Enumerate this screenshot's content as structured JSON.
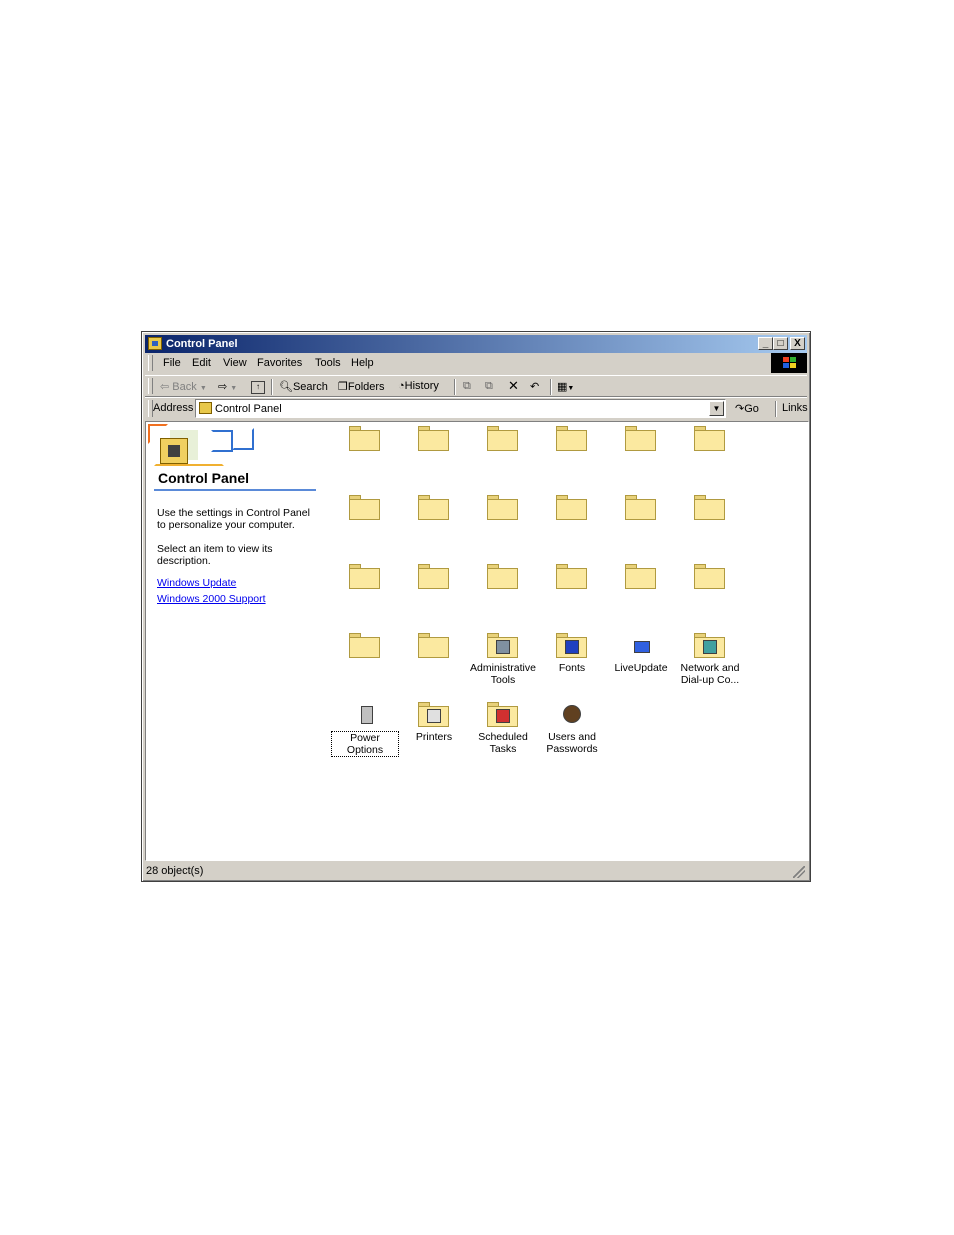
{
  "window": {
    "title": "Control Panel"
  },
  "title_buttons": {
    "minimize": "_",
    "maximize": "□",
    "close": "X"
  },
  "menu": [
    "File",
    "Edit",
    "View",
    "Favorites",
    "Tools",
    "Help"
  ],
  "toolbar": {
    "back": "Back",
    "search": "Search",
    "folders": "Folders",
    "history": "History"
  },
  "address": {
    "label": "Address",
    "value": "Control Panel",
    "go": "Go",
    "links": "Links"
  },
  "left_panel": {
    "title": "Control Panel",
    "description": "Use the settings in Control Panel to personalize your computer.",
    "hint": "Select an item to view its description.",
    "links": [
      "Windows Update",
      "Windows 2000 Support"
    ]
  },
  "items": [
    {
      "label": "",
      "icon": "folder-icon"
    },
    {
      "label": "",
      "icon": "folder-icon"
    },
    {
      "label": "",
      "icon": "folder-icon"
    },
    {
      "label": "",
      "icon": "folder-icon"
    },
    {
      "label": "",
      "icon": "folder-icon"
    },
    {
      "label": "",
      "icon": "folder-icon"
    },
    {
      "label": "",
      "icon": "folder-icon"
    },
    {
      "label": "",
      "icon": "folder-icon"
    },
    {
      "label": "",
      "icon": "folder-icon"
    },
    {
      "label": "",
      "icon": "folder-icon"
    },
    {
      "label": "",
      "icon": "folder-icon"
    },
    {
      "label": "",
      "icon": "folder-icon"
    },
    {
      "label": "",
      "icon": "folder-icon"
    },
    {
      "label": "",
      "icon": "folder-icon"
    },
    {
      "label": "",
      "icon": "folder-icon"
    },
    {
      "label": "",
      "icon": "folder-icon"
    },
    {
      "label": "",
      "icon": "folder-icon"
    },
    {
      "label": "",
      "icon": "folder-icon"
    },
    {
      "label": "",
      "icon": "folder-icon"
    },
    {
      "label": "",
      "icon": "folder-icon"
    },
    {
      "label": "Administrative Tools",
      "icon": "administrative-tools-icon"
    },
    {
      "label": "Fonts",
      "icon": "fonts-icon"
    },
    {
      "label": "LiveUpdate",
      "icon": "liveupdate-icon"
    },
    {
      "label": "Network and Dial-up Co...",
      "icon": "network-icon"
    },
    {
      "label": "Power Options",
      "icon": "power-options-icon",
      "selected": true
    },
    {
      "label": "Printers",
      "icon": "printers-icon"
    },
    {
      "label": "Scheduled Tasks",
      "icon": "scheduled-tasks-icon"
    },
    {
      "label": "Users and Passwords",
      "icon": "users-icon"
    }
  ],
  "status": {
    "text": "28 object(s)"
  }
}
